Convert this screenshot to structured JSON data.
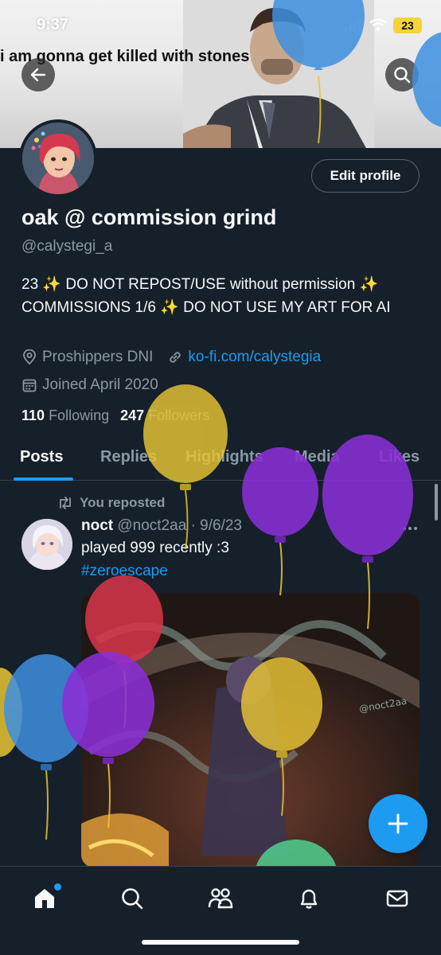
{
  "status_bar": {
    "time": "9:37",
    "battery": "23"
  },
  "banner": {
    "caption": "i am gonna get killed with stones"
  },
  "profile": {
    "edit_label": "Edit profile",
    "display_name": "oak @ commission grind",
    "handle": "@calystegi_a",
    "bio": "23 ✨ DO NOT REPOST/USE without permission ✨ COMMISSIONS 1/6 ✨ DO NOT USE MY ART FOR AI",
    "location": "Proshippers DNI",
    "link": "ko-fi.com/calystegia",
    "joined": "Joined April 2020",
    "following_count": "110",
    "following_label": "Following",
    "followers_count": "247",
    "followers_label": "Followers"
  },
  "tabs": [
    "Posts",
    "Replies",
    "Highlights",
    "Media",
    "Likes"
  ],
  "post": {
    "repost_label": "You reposted",
    "author": "noct",
    "handle_date": "@noct2aa · 9/6/23",
    "text": "played 999 recently :3",
    "hashtag": "#zeroescape",
    "watermark": "@noct2aa"
  },
  "icons": {
    "back": "arrow-left-icon",
    "search": "search-icon",
    "compose": "plus-icon",
    "nav": [
      "home-icon",
      "search-icon",
      "communities-icon",
      "bell-icon",
      "mail-icon"
    ]
  },
  "colors": {
    "background": "#15202b",
    "accent": "#1d9bf0",
    "secondary_text": "#8b98a5",
    "balloon_yellow": "#e8c534",
    "balloon_purple": "#8b2fd6",
    "balloon_blue": "#3d8fe0",
    "balloon_red": "#d9364a",
    "balloon_green": "#4fd08f"
  }
}
